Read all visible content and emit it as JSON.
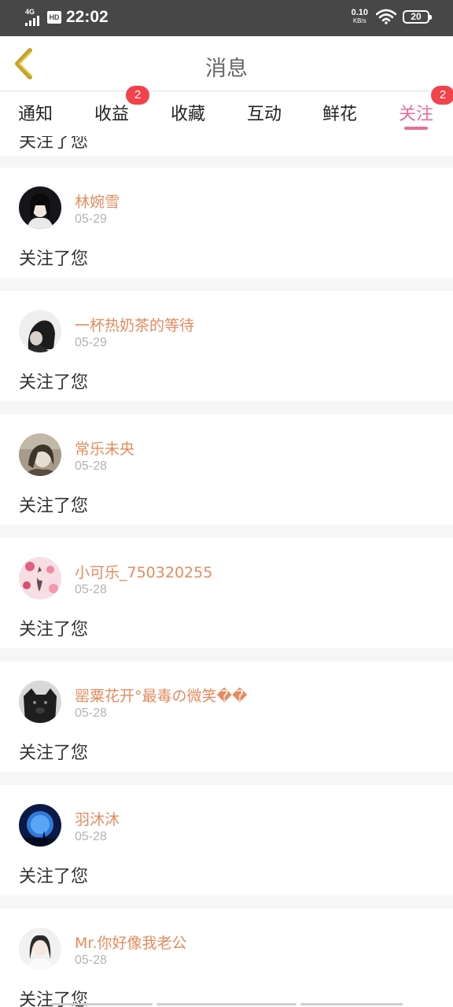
{
  "status_bar": {
    "network": "4G",
    "hd": "HD",
    "time": "22:02",
    "speed_value": "0.10",
    "speed_unit": "KB/s",
    "battery": "20"
  },
  "header": {
    "title": "消息",
    "back_icon": "chevron-left-icon",
    "back_icon_color": "#c9a227"
  },
  "tabs": [
    {
      "label": "通知",
      "badge": null
    },
    {
      "label": "收益",
      "badge": "2"
    },
    {
      "label": "收藏",
      "badge": null
    },
    {
      "label": "互动",
      "badge": null
    },
    {
      "label": "鲜花",
      "badge": null
    },
    {
      "label": "关注",
      "badge": "2",
      "active": true
    }
  ],
  "colors": {
    "accent": "#e76f9b",
    "username": "#e58b5e",
    "badge": "#f2434b",
    "date": "#b3b3b3"
  },
  "partial_item": {
    "message": "关注了您"
  },
  "items": [
    {
      "name": "林婉雪",
      "date": "05-29",
      "message": "关注了您"
    },
    {
      "name": "一杯热奶茶的等待",
      "date": "05-29",
      "message": "关注了您"
    },
    {
      "name": "常乐未央",
      "date": "05-28",
      "message": "关注了您"
    },
    {
      "name": "小可乐_750320255",
      "date": "05-28",
      "message": "关注了您"
    },
    {
      "name": "罂粟花开°最毒の微笑��",
      "date": "05-28",
      "message": "关注了您"
    },
    {
      "name": "羽沐沐",
      "date": "05-28",
      "message": "关注了您"
    },
    {
      "name": "Mr.你好像我老公",
      "date": "05-28",
      "message": "关注了您"
    }
  ]
}
